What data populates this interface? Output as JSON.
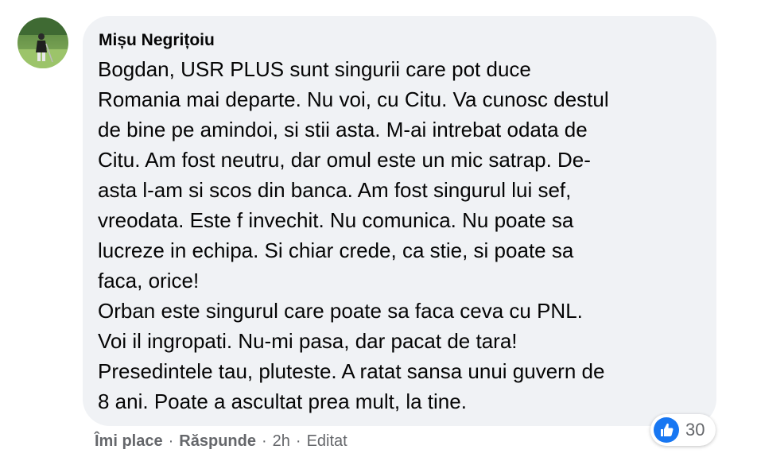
{
  "colors": {
    "bubble_bg": "#f0f2f5",
    "like_blue": "#1877f2",
    "meta_text": "#65676b"
  },
  "comment": {
    "author": "Mișu Negrițoiu",
    "lines": [
      "Bogdan, USR PLUS sunt singurii care pot duce",
      "Romania mai departe. Nu voi, cu Citu. Va cunosc destul",
      "de bine pe amindoi, si stii asta. M-ai intrebat odata de",
      "Citu. Am fost neutru, dar omul este un mic satrap. De-",
      "asta l-am si scos din banca. Am fost singurul lui sef,",
      "vreodata. Este f invechit. Nu comunica. Nu poate sa",
      "lucreze in echipa. Si chiar crede, ca stie, si poate sa",
      "faca, orice!",
      "Orban este singurul care poate sa faca ceva cu PNL.",
      "Voi il ingropati. Nu-mi pasa, dar pacat de tara!",
      "Presedintele tau, pluteste. A ratat sansa unui guvern de",
      "8 ani. Poate a ascultat prea mult, la tine."
    ]
  },
  "reactions": {
    "icon": "like-thumb-icon",
    "count": "30"
  },
  "actions": {
    "like": "Îmi place",
    "reply": "Răspunde",
    "separator": "·",
    "time": "2h",
    "edited": "Editat"
  }
}
